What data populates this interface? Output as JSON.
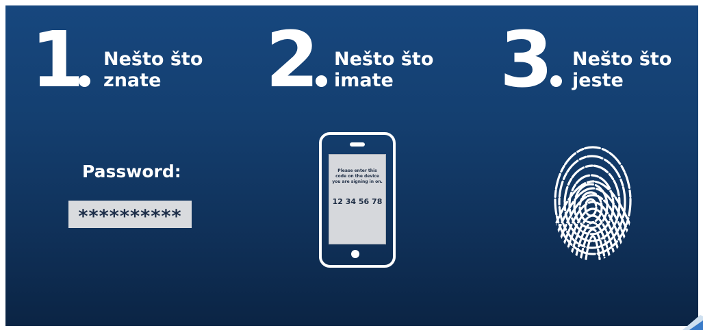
{
  "steps": [
    {
      "number": "1",
      "line1": "Nešto što",
      "line2": "znate"
    },
    {
      "number": "2",
      "line1": "Nešto što",
      "line2": "imate"
    },
    {
      "number": "3",
      "line1": "Nešto što",
      "line2": "jeste"
    }
  ],
  "password": {
    "label": "Password:",
    "value": "**********"
  },
  "phone": {
    "message": "Please enter this\ncode on the device\nyou are signing in on.",
    "code": "12 34 56 78"
  },
  "icons": {
    "phone": "smartphone-icon",
    "fingerprint": "fingerprint-icon"
  },
  "colors": {
    "background_top": "#17477e",
    "background_bottom": "#0b2444",
    "text": "#ffffff",
    "password_box": "#d9dbde"
  }
}
